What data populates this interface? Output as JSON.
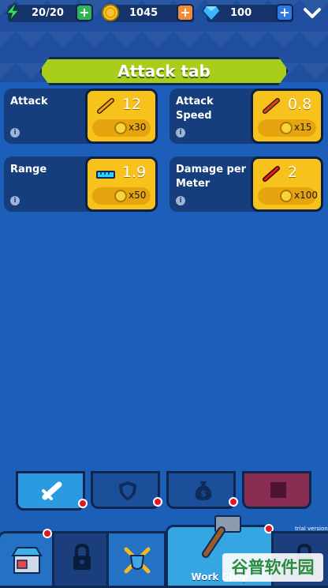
{
  "resources": {
    "energy": {
      "value": "20/20"
    },
    "coins": {
      "value": "1045"
    },
    "gems": {
      "value": "100"
    }
  },
  "title": "Attack tab",
  "stats": [
    {
      "label": "Attack",
      "value": "12",
      "price": "x30"
    },
    {
      "label": "Attack Speed",
      "value": "0.8",
      "price": "x15"
    },
    {
      "label": "Range",
      "value": "1.9",
      "price": "x50"
    },
    {
      "label": "Damage per Meter",
      "value": "2",
      "price": "x100"
    }
  ],
  "info_glyph": "i",
  "subtabs": [
    "sword-icon",
    "shield-icon",
    "money-bag-icon",
    "box-icon"
  ],
  "nav": {
    "workshop_label": "Work Shop"
  },
  "watermark": "谷普软件园",
  "trial_text": "trial version",
  "colors": {
    "accent_green": "#a8cd1b",
    "gold": "#f8c21c",
    "bg_blue": "#1d5ebb",
    "notify_red": "#e0162a"
  }
}
